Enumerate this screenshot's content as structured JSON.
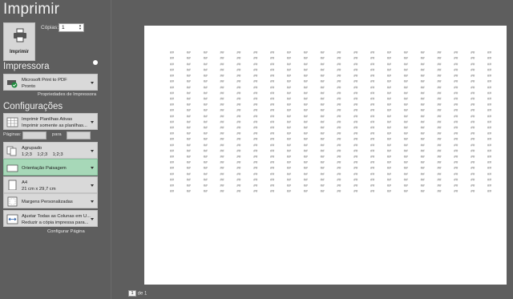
{
  "title": "Imprimir",
  "print_button": {
    "label": "Imprimir",
    "icon": "printer-icon"
  },
  "copies": {
    "label": "Cópias:",
    "value": "1"
  },
  "printer": {
    "heading": "Impressora",
    "name": "Microsoft Print to PDF",
    "status": "Pronto",
    "properties_link": "Propriedades de Impressora"
  },
  "settings": {
    "heading": "Configurações",
    "what": {
      "line1": "Imprimir Planilhas Ativas",
      "line2": "Imprimir somente as planilhas..."
    },
    "pages": {
      "label": "Páginas:",
      "to": "para"
    },
    "collate": {
      "line1": "Agrupado",
      "line2": "1;2;3    1;2;3    1;2;3"
    },
    "orientation": {
      "line1": "Orientação Paisagem"
    },
    "paper": {
      "line1": "A4",
      "line2": "21 cm x 29,7 cm"
    },
    "margins": {
      "line1": "Margens Personalizadas"
    },
    "scaling": {
      "line1": "Ajustar Todas as Colunas em U...",
      "line2": "Reduzir a cópia impressa para..."
    },
    "page_setup_link": "Configurar Página"
  },
  "preview": {
    "cell_text": "##",
    "columns": 20,
    "rows": 25
  },
  "page_nav": {
    "current": "1",
    "of_label": "de 1"
  }
}
